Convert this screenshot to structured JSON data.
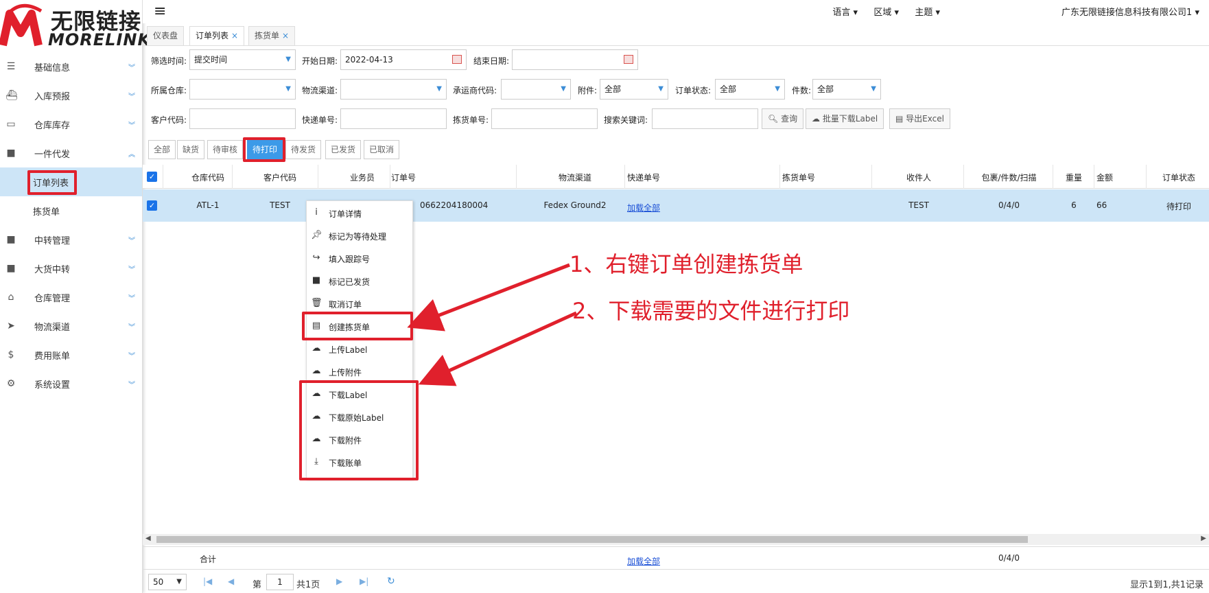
{
  "brand": {
    "cn": "无限链接",
    "en": "MORELINK",
    "accent": "#e0202c"
  },
  "sidebar": {
    "items": [
      {
        "label": "基础信息",
        "icon": "list-icon"
      },
      {
        "label": "入库预报",
        "icon": "ship-icon"
      },
      {
        "label": "仓库库存",
        "icon": "inbox-icon"
      },
      {
        "label": "一件代发",
        "icon": "truck-icon"
      },
      {
        "label": "中转管理",
        "icon": "truck-icon"
      },
      {
        "label": "大货中转",
        "icon": "truck-icon"
      },
      {
        "label": "仓库管理",
        "icon": "home-icon"
      },
      {
        "label": "物流渠道",
        "icon": "cursor-icon"
      },
      {
        "label": "费用账单",
        "icon": "dollar-icon"
      },
      {
        "label": "系统设置",
        "icon": "gear-icon"
      }
    ],
    "subitems": [
      {
        "label": "订单列表"
      },
      {
        "label": "拣货单"
      }
    ]
  },
  "topbar": {
    "lang": "语言",
    "region": "区域",
    "theme": "主题",
    "company": "广东无限链接信息科技有限公司1"
  },
  "tabs": [
    {
      "label": "仪表盘"
    },
    {
      "label": "订单列表"
    },
    {
      "label": "拣货单"
    }
  ],
  "filters": {
    "filter_time_label": "筛选时间:",
    "filter_time_value": "提交时间",
    "start_date_label": "开始日期:",
    "start_date_value": "2022-04-13",
    "end_date_label": "结束日期:",
    "end_date_value": "",
    "warehouse_label": "所属仓库:",
    "channel_label": "物流渠道:",
    "carrier_label": "承运商代码:",
    "attach_label": "附件:",
    "attach_value": "全部",
    "status_label": "订单状态:",
    "status_value": "全部",
    "pieces_label": "件数:",
    "pieces_value": "全部",
    "customer_label": "客户代码:",
    "express_label": "快递单号:",
    "picking_label": "拣货单号:",
    "keyword_label": "搜索关键词:",
    "query_btn": "查询",
    "batch_btn": "批量下载Label",
    "excel_btn": "导出Excel"
  },
  "status_tabs": [
    "全部",
    "缺货",
    "待审核",
    "待打印",
    "待发货",
    "已发货",
    "已取消"
  ],
  "table": {
    "headers": [
      "仓库代码",
      "客户代码",
      "业务员",
      "订单号",
      "物流渠道",
      "快递单号",
      "拣货单号",
      "收件人",
      "包裹/件数/扫描",
      "重量",
      "金额",
      "订单状态"
    ],
    "row": {
      "warehouse": "ATL-1",
      "customer": "TEST",
      "salesman": "",
      "order": "0662204180004",
      "channel": "Fedex Ground2",
      "express": "加载全部",
      "picking": "",
      "receiver": "TEST",
      "packages": "0/4/0",
      "weight": "6",
      "amount": "66",
      "status": "待打印"
    },
    "footer": {
      "total": "合计",
      "express": "加载全部",
      "packages": "0/4/0"
    }
  },
  "pager": {
    "size": "50",
    "page_prefix": "第",
    "page": "1",
    "page_suffix": "共1页",
    "summary": "显示1到1,共1记录"
  },
  "context_menu": [
    {
      "label": "订单详情",
      "icon": "info-icon"
    },
    {
      "label": "标记为等待处理",
      "icon": "pin-icon"
    },
    {
      "label": "填入跟踪号",
      "icon": "share-icon"
    },
    {
      "label": "标记已发货",
      "icon": "truck-icon"
    },
    {
      "label": "取消订单",
      "icon": "trash-icon"
    },
    {
      "label": "创建拣货单",
      "icon": "list-icon"
    },
    {
      "label": "上传Label",
      "icon": "cloud-upload-icon"
    },
    {
      "label": "上传附件",
      "icon": "cloud-upload-icon"
    },
    {
      "label": "下载Label",
      "icon": "cloud-download-icon"
    },
    {
      "label": "下载原始Label",
      "icon": "cloud-download-icon"
    },
    {
      "label": "下载附件",
      "icon": "cloud-download-icon"
    },
    {
      "label": "下载账单",
      "icon": "download-icon"
    }
  ],
  "annotations": {
    "step1": "1、右键订单创建拣货单",
    "step2": "2、下载需要的文件进行打印"
  }
}
